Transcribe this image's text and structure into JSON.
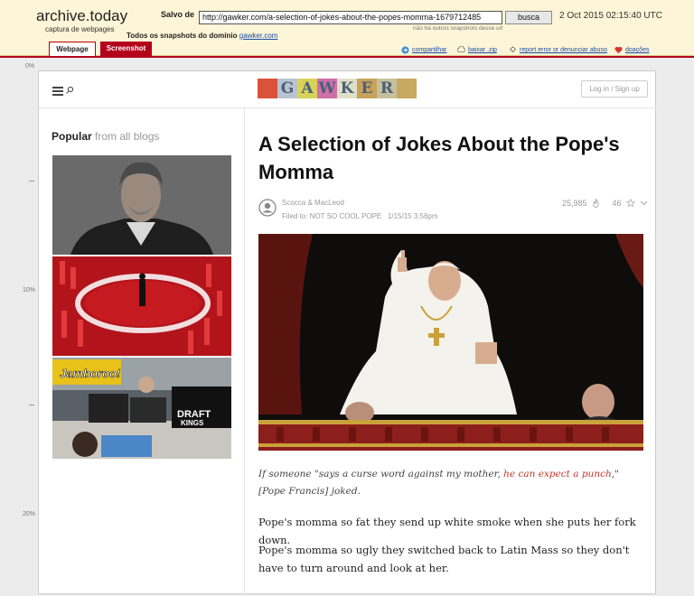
{
  "archive": {
    "brand": "archive.today",
    "subtitle": "captura de webpages",
    "saved_label": "Salvo de",
    "url": "http://gawker.com/a-selection-of-jokes-about-the-popes-momma-1679712485",
    "search_label": "busca",
    "capture_date": "2 Oct 2015 02:15:40 UTC",
    "no_snapshots": "não há outros snapshots desse url",
    "all_snapshots": "Todos os snapshots  do domínio",
    "domain_link": "gawker.com",
    "tabs": {
      "webpage": "Webpage",
      "screenshot": "Screenshot"
    },
    "links": {
      "share": "compartilhar",
      "download": "baixar .zip",
      "report": "report error or denunciar abuso",
      "donate": "doações"
    }
  },
  "ruler": {
    "top": "0%",
    "mid1": "10%",
    "mid2": "20%"
  },
  "site": {
    "logo_letters": [
      "",
      "G",
      "A",
      "W",
      "K",
      "E",
      "R",
      ""
    ],
    "logo_colors": [
      "#d9533a",
      "#b9c3d0",
      "#d9d25a",
      "#cf6fa7",
      "#e0e0c8",
      "#c8a25a",
      "#c6c19b",
      "#c9a862"
    ],
    "login_label": "Log in / Sign up"
  },
  "sidebar": {
    "popular": "Popular",
    "from_blogs": "from all blogs"
  },
  "article": {
    "headline": "A Selection of Jokes About the Pope's Momma",
    "authors": "Scocca & MacLeod",
    "filed_label": "Filed to: NOT SO COOL POPE",
    "date": "1/15/15 3:56pm",
    "views": "25,985",
    "comments": "46",
    "caption_pre": "If someone \"says a curse word against my mother, ",
    "caption_link": "he can expect a punch",
    "caption_post": ",\" [Pope Francis] joked.",
    "para1": "Pope's momma so fat they send up white smoke when she puts her fork down.",
    "para2": "Pope's momma so ugly they switched back to Latin Mass so they don't have to turn around and look at her."
  }
}
